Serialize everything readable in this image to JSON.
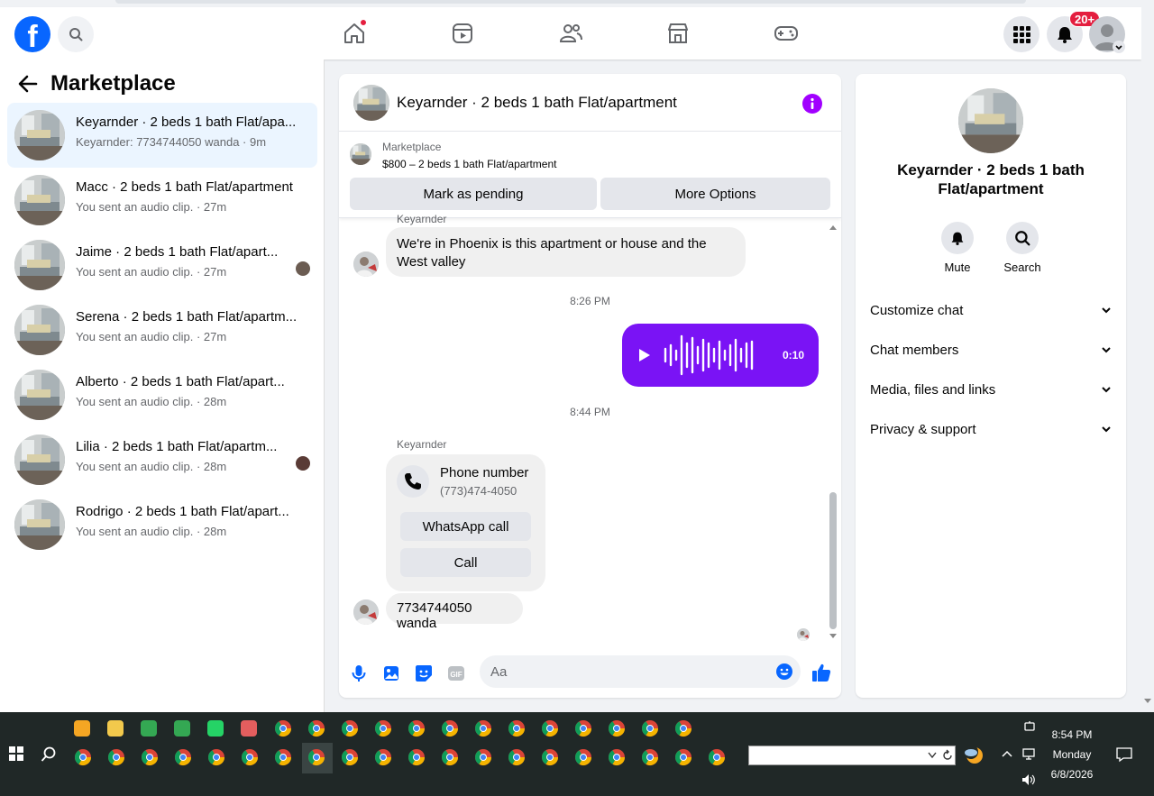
{
  "header": {
    "notif_badge": "20+"
  },
  "left_panel": {
    "title": "Marketplace",
    "conversations": [
      {
        "name": "Keyarnder · 2 beds 1 bath Flat/apa...",
        "sub": "Keyarnder: 7734744050 wanda · 9m"
      },
      {
        "name": "Macc · 2 beds 1 bath Flat/apartment",
        "sub": "You sent an audio clip. · 27m"
      },
      {
        "name": "Jaime · 2 beds 1 bath Flat/apart...",
        "sub": "You sent an audio clip. · 27m"
      },
      {
        "name": "Serena · 2 beds 1 bath Flat/apartm...",
        "sub": "You sent an audio clip. · 27m"
      },
      {
        "name": "Alberto · 2 beds 1 bath Flat/apart...",
        "sub": "You sent an audio clip. · 28m"
      },
      {
        "name": "Lilia · 2 beds 1 bath Flat/apartm...",
        "sub": "You sent an audio clip. · 28m"
      },
      {
        "name": "Rodrigo · 2 beds 1 bath Flat/apart...",
        "sub": "You sent an audio clip. · 28m"
      }
    ]
  },
  "chat": {
    "title": "Keyarnder · 2 beds 1 bath Flat/apartment",
    "marketplace_label": "Marketplace",
    "listing": "$800 – 2 beds 1 bath Flat/apartment",
    "mark_pending": "Mark as pending",
    "more_options": "More Options",
    "sender_cut": "Keyarnder",
    "msg1": "We're in Phoenix is this apartment or house and the West valley",
    "time1": "8:26 PM",
    "audio_duration": "0:10",
    "time2": "8:44 PM",
    "sender": "Keyarnder",
    "phone_title": "Phone number",
    "phone_number": "(773)474-4050",
    "whatsapp_call": "WhatsApp call",
    "call": "Call",
    "msg2": "7734744050 wanda",
    "input_placeholder": "Aa"
  },
  "right_panel": {
    "title": "Keyarnder · 2 beds 1 bath Flat/apartment",
    "mute": "Mute",
    "search": "Search",
    "sections": [
      "Customize chat",
      "Chat members",
      "Media, files and links",
      "Privacy & support"
    ]
  },
  "taskbar": {
    "time": "8:54 PM",
    "day": "Monday",
    "date": "6/8/2026"
  },
  "colors": {
    "accent": "#0866ff",
    "audio": "#7a13f5",
    "info": "#a100ff"
  }
}
